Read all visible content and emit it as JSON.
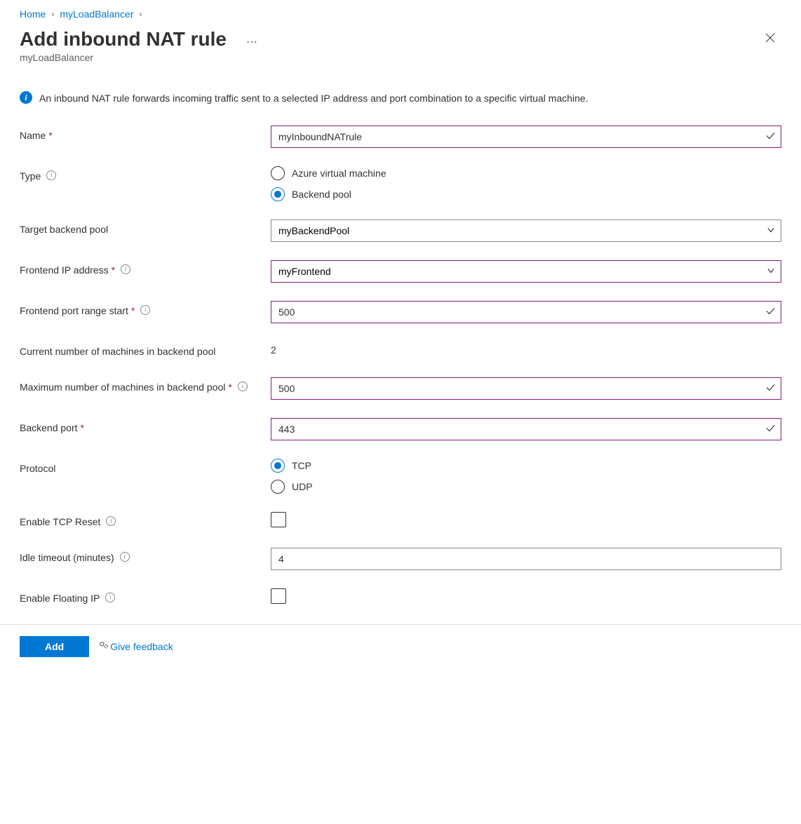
{
  "breadcrumb": {
    "home": "Home",
    "lb": "myLoadBalancer"
  },
  "header": {
    "title": "Add inbound NAT rule",
    "subtitle": "myLoadBalancer"
  },
  "info": "An inbound NAT rule forwards incoming traffic sent to a selected IP address and port combination to a specific virtual machine.",
  "labels": {
    "name": "Name",
    "type": "Type",
    "target_backend_pool": "Target backend pool",
    "frontend_ip": "Frontend IP address",
    "frontend_port_start": "Frontend port range start",
    "current_machines": "Current number of machines in backend pool",
    "max_machines": "Maximum number of machines in backend pool",
    "backend_port": "Backend port",
    "protocol": "Protocol",
    "tcp_reset": "Enable TCP Reset",
    "idle_timeout": "Idle timeout (minutes)",
    "floating_ip": "Enable Floating IP"
  },
  "type_options": {
    "vm": "Azure virtual machine",
    "pool": "Backend pool"
  },
  "protocol_options": {
    "tcp": "TCP",
    "udp": "UDP"
  },
  "fields": {
    "name": "myInboundNATrule",
    "type_selected": "pool",
    "target_backend_pool": "myBackendPool",
    "frontend_ip": "myFrontend",
    "frontend_port_start": "500",
    "current_machines": "2",
    "max_machines": "500",
    "backend_port": "443",
    "protocol_selected": "tcp",
    "idle_timeout": "4"
  },
  "footer": {
    "add": "Add",
    "feedback": "Give feedback"
  }
}
